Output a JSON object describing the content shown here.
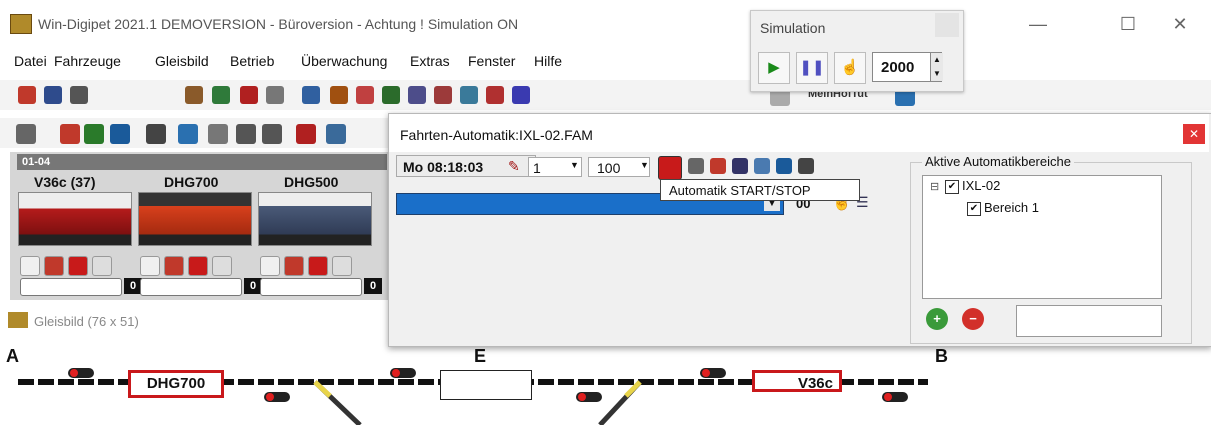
{
  "window": {
    "title": "Win-Digipet 2021.1 DEMOVERSION - Büroversion - Achtung ! Simulation ON",
    "minimize": "—",
    "maximize": "☐",
    "close": "✕"
  },
  "menu": [
    "Datei",
    "Fahrzeuge",
    "Gleisbild",
    "Betrieb",
    "Überwachung",
    "Extras",
    "Fenster",
    "Hilfe"
  ],
  "toolbar": {
    "profile_label": "MeinHofTut"
  },
  "simulation": {
    "title": "Simulation",
    "speed": "2000"
  },
  "locos": {
    "tab": "01-04",
    "names": [
      "V36c (37)",
      "DHG700",
      "DHG500"
    ],
    "zero": "0"
  },
  "gleisbild": {
    "title": "Gleisbild (76 x 51)",
    "labels": {
      "a": "A",
      "e": "E",
      "b": "B"
    },
    "boxes": {
      "left": "DHG700",
      "right": "V36c"
    }
  },
  "fahrten": {
    "title": "Fahrten-Automatik:IXL-02.FAM",
    "clock": "Mo 08:18:03",
    "value1": "1",
    "value2": "100",
    "tooltip": "Automatik START/STOP",
    "bluebar_text": "00"
  },
  "aab": {
    "title": "Aktive Automatikbereiche",
    "tree": {
      "root": "IXL-02",
      "child": "Bereich 1"
    }
  },
  "colors": {
    "blue": "#1a6fc9",
    "red": "#c9181b",
    "green": "#2a8a2a"
  }
}
